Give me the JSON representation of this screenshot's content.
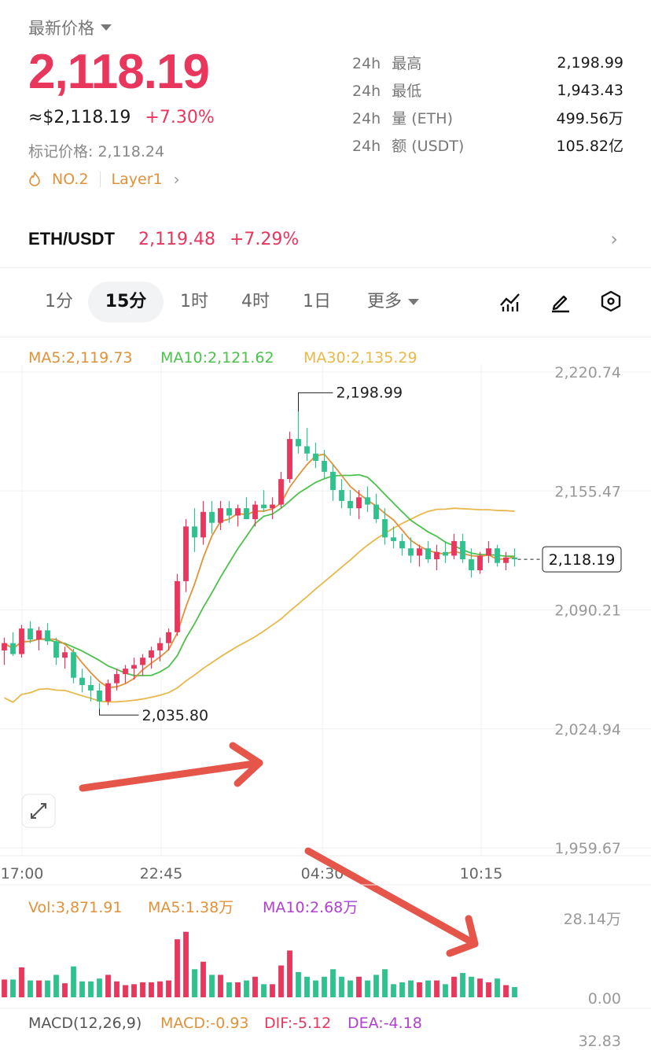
{
  "header": {
    "latest_label": "最新价格",
    "price": "2,118.19",
    "usd_price": "≈$2,118.19",
    "change_pct": "+7.30%",
    "mark_price": "标记价格: 2,118.24",
    "tag_rank": "NO.2",
    "tag_category": "Layer1"
  },
  "stats": [
    {
      "period": "24h",
      "label": "最高",
      "value": "2,198.99"
    },
    {
      "period": "24h",
      "label": "最低",
      "value": "1,943.43"
    },
    {
      "period": "24h",
      "label": "量 (ETH)",
      "value": "499.56万"
    },
    {
      "period": "24h",
      "label": "额 (USDT)",
      "value": "105.82亿"
    }
  ],
  "pair": {
    "name": "ETH/USDT",
    "price": "2,119.48",
    "change": "+7.29%"
  },
  "tabs": [
    "1分",
    "15分",
    "1时",
    "4时",
    "1日",
    "更多"
  ],
  "active_tab": "15分",
  "tools": [
    "indicator-icon",
    "draw-icon",
    "settings-hexagon-icon"
  ],
  "colors": {
    "up": "#e8365d",
    "down": "#2fc28e",
    "ma5": "#e0923a",
    "ma10": "#4cc14c",
    "ma30": "#e8b84a",
    "vol_ma10": "#b040d0"
  },
  "ma_legend": {
    "ma5": "MA5:2,119.73",
    "ma10": "MA10:2,121.62",
    "ma30": "MA30:2,135.29"
  },
  "chart_data": {
    "type": "candlestick",
    "y_ticks": [
      "2,220.74",
      "2,155.47",
      "2,090.21",
      "2,024.94",
      "1,959.67"
    ],
    "x_ticks": [
      "17:00",
      "22:45",
      "04:30",
      "10:15"
    ],
    "ylim": [
      1959.67,
      2220.74
    ],
    "high_label": "2,198.99",
    "low_label": "2,035.80",
    "last_price_label": "2,118.19",
    "candles": [
      [
        2068,
        2075,
        2060,
        2072
      ],
      [
        2072,
        2078,
        2065,
        2066
      ],
      [
        2066,
        2082,
        2064,
        2080
      ],
      [
        2080,
        2084,
        2072,
        2074
      ],
      [
        2074,
        2081,
        2068,
        2079
      ],
      [
        2079,
        2083,
        2071,
        2073
      ],
      [
        2073,
        2075,
        2060,
        2064
      ],
      [
        2064,
        2070,
        2058,
        2067
      ],
      [
        2067,
        2069,
        2050,
        2053
      ],
      [
        2053,
        2058,
        2045,
        2049
      ],
      [
        2049,
        2054,
        2040,
        2046
      ],
      [
        2046,
        2050,
        2036,
        2040
      ],
      [
        2040,
        2052,
        2038,
        2050
      ],
      [
        2050,
        2058,
        2046,
        2055
      ],
      [
        2055,
        2060,
        2050,
        2058
      ],
      [
        2058,
        2064,
        2052,
        2060
      ],
      [
        2060,
        2066,
        2054,
        2064
      ],
      [
        2064,
        2070,
        2058,
        2068
      ],
      [
        2068,
        2075,
        2062,
        2072
      ],
      [
        2072,
        2080,
        2068,
        2078
      ],
      [
        2078,
        2110,
        2076,
        2106
      ],
      [
        2106,
        2140,
        2100,
        2136
      ],
      [
        2136,
        2146,
        2122,
        2130
      ],
      [
        2130,
        2150,
        2126,
        2144
      ],
      [
        2144,
        2150,
        2132,
        2138
      ],
      [
        2138,
        2150,
        2134,
        2146
      ],
      [
        2146,
        2150,
        2138,
        2142
      ],
      [
        2142,
        2148,
        2136,
        2146
      ],
      [
        2146,
        2152,
        2140,
        2140
      ],
      [
        2140,
        2150,
        2136,
        2148
      ],
      [
        2148,
        2156,
        2144,
        2146
      ],
      [
        2146,
        2152,
        2140,
        2148
      ],
      [
        2148,
        2166,
        2146,
        2162
      ],
      [
        2162,
        2188,
        2160,
        2184
      ],
      [
        2184,
        2199,
        2176,
        2180
      ],
      [
        2180,
        2190,
        2172,
        2176
      ],
      [
        2176,
        2182,
        2168,
        2172
      ],
      [
        2172,
        2178,
        2162,
        2166
      ],
      [
        2166,
        2170,
        2150,
        2156
      ],
      [
        2156,
        2162,
        2146,
        2150
      ],
      [
        2150,
        2156,
        2142,
        2146
      ],
      [
        2146,
        2156,
        2140,
        2152
      ],
      [
        2152,
        2158,
        2144,
        2148
      ],
      [
        2148,
        2154,
        2138,
        2140
      ],
      [
        2140,
        2146,
        2126,
        2130
      ],
      [
        2130,
        2136,
        2124,
        2128
      ],
      [
        2128,
        2132,
        2120,
        2124
      ],
      [
        2124,
        2130,
        2116,
        2120
      ],
      [
        2120,
        2126,
        2114,
        2124
      ],
      [
        2124,
        2128,
        2116,
        2118
      ],
      [
        2118,
        2126,
        2112,
        2122
      ],
      [
        2122,
        2128,
        2116,
        2120
      ],
      [
        2120,
        2132,
        2118,
        2128
      ],
      [
        2128,
        2132,
        2116,
        2118
      ],
      [
        2118,
        2124,
        2108,
        2112
      ],
      [
        2112,
        2122,
        2110,
        2120
      ],
      [
        2120,
        2128,
        2116,
        2124
      ],
      [
        2124,
        2126,
        2114,
        2116
      ],
      [
        2116,
        2122,
        2112,
        2119
      ],
      [
        2119,
        2124,
        2114,
        2118
      ]
    ],
    "volume_ticks": [
      "28.14万",
      "0.00"
    ],
    "volume_legend": {
      "vol": "Vol:3,871.91",
      "ma5": "MA5:1.38万",
      "ma10": "MA10:2.68万"
    },
    "macd_legend": {
      "title": "MACD(12,26,9)",
      "macd": "MACD:-0.93",
      "dif": "DIF:-5.12",
      "dea": "DEA:-4.18"
    },
    "macd_tick": "32.83"
  }
}
